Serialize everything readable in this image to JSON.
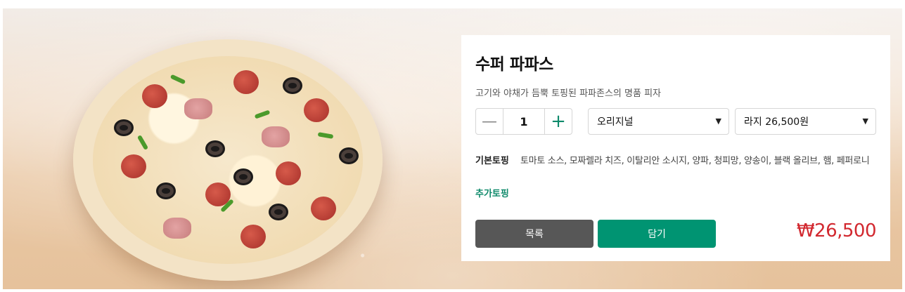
{
  "product": {
    "name": "수퍼 파파스",
    "description": "고기와 야채가 듬뿍 토핑된 파파존스의 명품 피자"
  },
  "quantity": {
    "value": "1",
    "minus": "—",
    "plus": "+"
  },
  "options": {
    "dough": {
      "selected": "오리지널",
      "icon": "chevron-down"
    },
    "size": {
      "selected": "라지 26,500원",
      "icon": "chevron-down"
    }
  },
  "toppings": {
    "base_label": "기본토핑",
    "base_value": "토마토 소스, 모짜렐라 치즈, 이탈리안 소시지, 양파, 청피망, 양송이, 블랙 올리브, 햄, 페퍼로니",
    "extra_label": "추가토핑"
  },
  "buttons": {
    "list": "목록",
    "add": "담기"
  },
  "price": "₩26,500",
  "colors": {
    "accent": "#009472",
    "price": "#d2282f",
    "list_button": "#575757"
  }
}
